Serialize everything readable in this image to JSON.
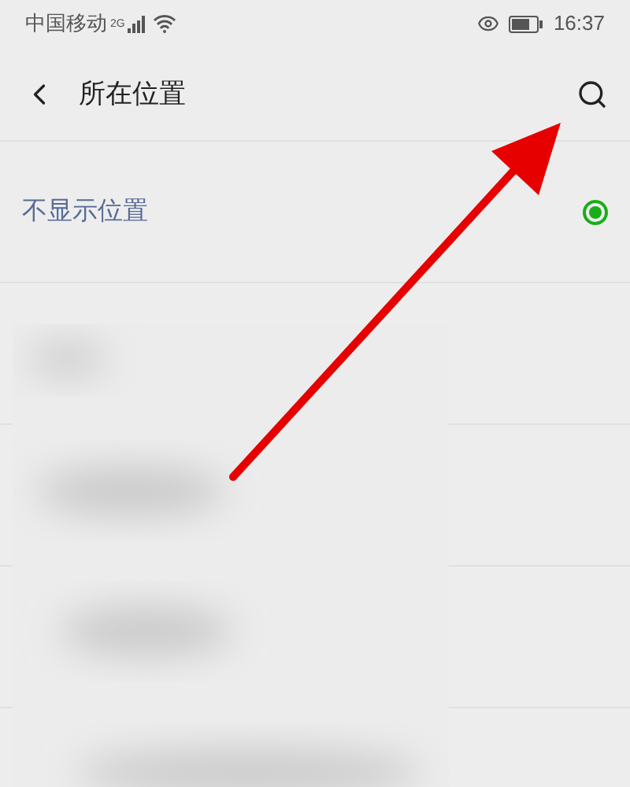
{
  "status_bar": {
    "carrier": "中国移动",
    "network": "2G",
    "time": "16:37"
  },
  "header": {
    "title": "所在位置"
  },
  "options": [
    {
      "label": "不显示位置",
      "selected": true
    }
  ]
}
